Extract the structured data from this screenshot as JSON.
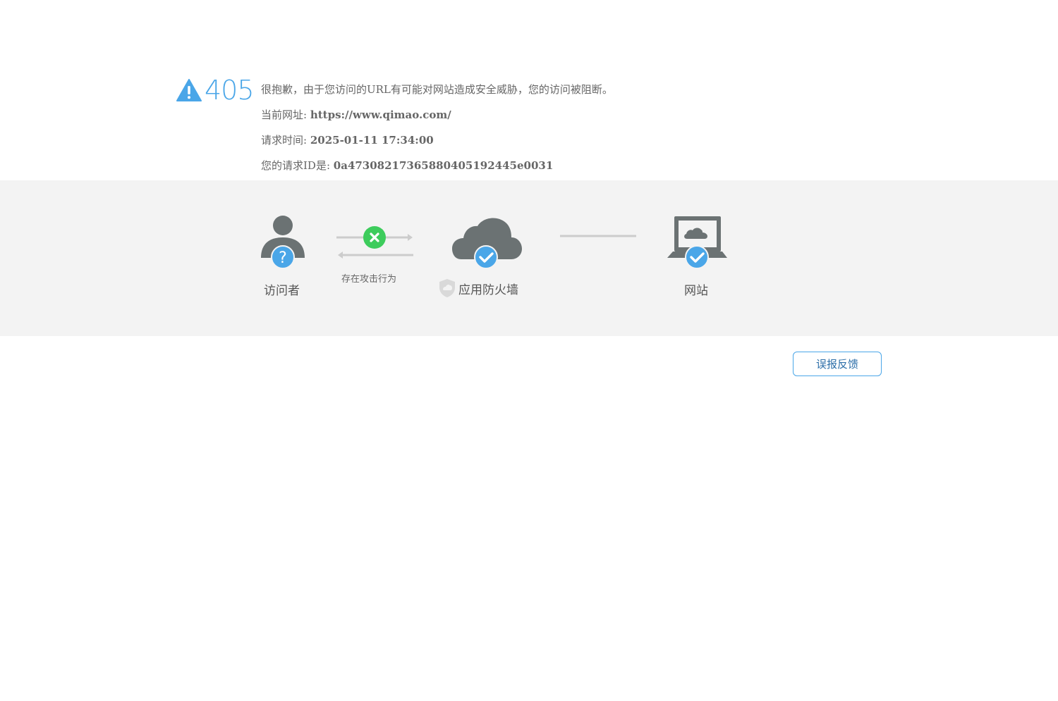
{
  "error": {
    "code": "405",
    "message": "很抱歉，由于您访问的URL有可能对网站造成安全威胁，您的访问被阻断。",
    "url_label": "当前网址: ",
    "url_value": "https://www.qimao.com/",
    "time_label": "请求时间: ",
    "time_value": "2025-01-11 17:34:00",
    "id_label": "您的请求ID是: ",
    "id_value": "0a4730821736588040519​2445e0031"
  },
  "diagram": {
    "visitor_label": "访问者",
    "attack_label": "存在攻击行为",
    "firewall_label": "应用防火墙",
    "website_label": "网站"
  },
  "actions": {
    "feedback_label": "误报反馈"
  },
  "colors": {
    "accent": "#4aa6e8",
    "icon_gray": "#6b7273",
    "blocked_green": "#3dcc5c",
    "band_bg": "#f3f3f3"
  }
}
